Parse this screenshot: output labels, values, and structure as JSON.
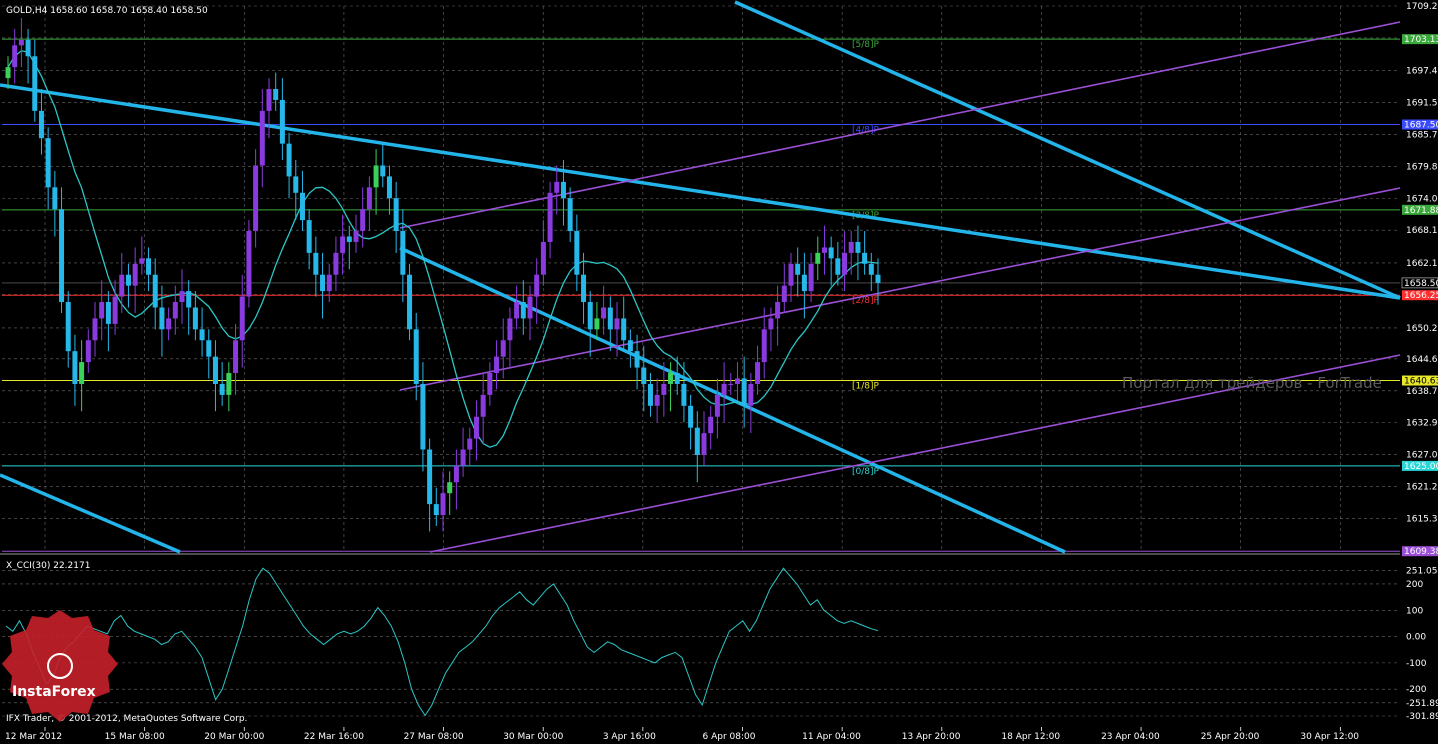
{
  "header": {
    "symbol_line": "GOLD,H4  1658.60 1658.70 1658.40 1658.50"
  },
  "indicator": {
    "label": "X_CCI(30) 22.2171"
  },
  "footer": {
    "copyright": "IFX Trader, © 2001-2012, MetaQuotes Software Corp."
  },
  "logo": {
    "brand": "InstaForex"
  },
  "watermark": "Портал для трейдеров - ForTrade",
  "colors": {
    "bull": "#8a3be0",
    "bear": "#27b8ea",
    "bull_alt": "#3ad15a",
    "ma": "#2cc6c6",
    "channel_purple": "#9b4fd6",
    "trend_cyan": "#23b4ea",
    "grid": "#6b6b6b"
  },
  "chart_data": [
    {
      "type": "candlestick",
      "symbol": "GOLD",
      "timeframe": "H4",
      "ylim": [
        1609.6,
        1709.2
      ],
      "y_ticks": [
        1709.2,
        1703.35,
        1697.4,
        1691.55,
        1685.7,
        1679.8,
        1674.0,
        1668.15,
        1662.15,
        1656.4,
        1650.25,
        1644.6,
        1638.75,
        1632.9,
        1627.05,
        1621.2,
        1615.35
      ],
      "x_tick_labels": [
        "12 Mar 2012",
        "15 Mar 08:00",
        "20 Mar 00:00",
        "22 Mar 16:00",
        "27 Mar 08:00",
        "30 Mar 00:00",
        "3 Apr 16:00",
        "6 Apr 08:00",
        "11 Apr 04:00",
        "13 Apr 20:00",
        "18 Apr 12:00",
        "23 Apr 04:00",
        "25 Apr 20:00",
        "30 Apr 12:00"
      ],
      "current_price": 1658.5,
      "current_price_label": "1658.50",
      "murrey_levels": [
        {
          "price": 1703.13,
          "label": "1703.13",
          "tag": "[5/8]P",
          "color": "#3aa83a"
        },
        {
          "price": 1687.5,
          "label": "1687.50",
          "tag": "[4/8]P",
          "color": "#3b4bff"
        },
        {
          "price": 1671.88,
          "label": "1671.88",
          "tag": "[3/8]P",
          "color": "#3aa83a"
        },
        {
          "price": 1656.25,
          "label": "1656.25",
          "tag": "[2/8]P",
          "color": "#ff3030"
        },
        {
          "price": 1640.63,
          "label": "1640.63",
          "tag": "[1/8]P",
          "color": "#e8e82a"
        },
        {
          "price": 1625.0,
          "label": "1625.00",
          "tag": "[0/8]P",
          "color": "#2ad6d6"
        },
        {
          "price": 1609.38,
          "label": "1609.38",
          "tag": "",
          "color": "#9b4fd6"
        }
      ],
      "closes": [
        1698,
        1702,
        1703,
        1700,
        1690,
        1685,
        1676,
        1672,
        1655,
        1646,
        1640,
        1644,
        1648,
        1652,
        1655,
        1651,
        1656,
        1660,
        1658,
        1662,
        1663,
        1660,
        1654,
        1650,
        1652,
        1655,
        1657,
        1654,
        1650,
        1648,
        1645,
        1640,
        1638,
        1642,
        1648,
        1656,
        1668,
        1680,
        1690,
        1694,
        1692,
        1684,
        1678,
        1675,
        1670,
        1664,
        1660,
        1657,
        1660,
        1664,
        1667,
        1666,
        1668,
        1672,
        1676,
        1680,
        1678,
        1674,
        1668,
        1660,
        1650,
        1640,
        1628,
        1618,
        1616,
        1620,
        1622,
        1625,
        1628,
        1630,
        1634,
        1638,
        1642,
        1645,
        1648,
        1652,
        1655,
        1652,
        1656,
        1660,
        1666,
        1675,
        1677,
        1674,
        1668,
        1660,
        1655,
        1650,
        1652,
        1654,
        1650,
        1652,
        1648,
        1646,
        1643,
        1640,
        1636,
        1638,
        1640,
        1642,
        1640,
        1636,
        1632,
        1627,
        1631,
        1634,
        1638,
        1640,
        1640,
        1641,
        1636,
        1640,
        1644,
        1650,
        1652,
        1655,
        1658,
        1662,
        1660,
        1657,
        1662,
        1664,
        1665,
        1663,
        1660,
        1664,
        1666,
        1664,
        1662,
        1660,
        1658.5
      ],
      "cci": {
        "name": "X_CCI(30)",
        "ylim": [
          -301.894,
          291.054
        ],
        "y_ticks": [
          251.054,
          200,
          100,
          0,
          -100,
          -200,
          -251.894,
          -301.894
        ],
        "y_tick_labels": [
          "251.054",
          "200",
          "100",
          "0.00",
          "-100",
          "-200",
          "-251.894",
          "-301.894"
        ],
        "values": [
          40,
          20,
          60,
          10,
          -60,
          -120,
          -180,
          -150,
          -80,
          -40,
          -20,
          10,
          40,
          30,
          20,
          10,
          60,
          80,
          40,
          20,
          10,
          0,
          -10,
          -30,
          -20,
          10,
          20,
          -10,
          -40,
          -80,
          -160,
          -240,
          -200,
          -120,
          -40,
          40,
          140,
          220,
          260,
          240,
          200,
          160,
          120,
          80,
          40,
          10,
          -10,
          -30,
          -10,
          10,
          20,
          10,
          20,
          40,
          70,
          110,
          80,
          40,
          -20,
          -100,
          -200,
          -260,
          -300,
          -260,
          -200,
          -140,
          -100,
          -60,
          -40,
          -20,
          10,
          40,
          80,
          110,
          130,
          150,
          170,
          140,
          120,
          150,
          180,
          200,
          160,
          120,
          60,
          10,
          -40,
          -60,
          -40,
          -20,
          -30,
          -50,
          -60,
          -70,
          -80,
          -90,
          -100,
          -80,
          -70,
          -60,
          -80,
          -150,
          -220,
          -260,
          -180,
          -100,
          -40,
          20,
          40,
          60,
          20,
          60,
          120,
          180,
          220,
          260,
          230,
          200,
          160,
          120,
          140,
          100,
          80,
          60,
          50,
          60,
          50,
          40,
          30,
          22.2
        ]
      }
    }
  ]
}
